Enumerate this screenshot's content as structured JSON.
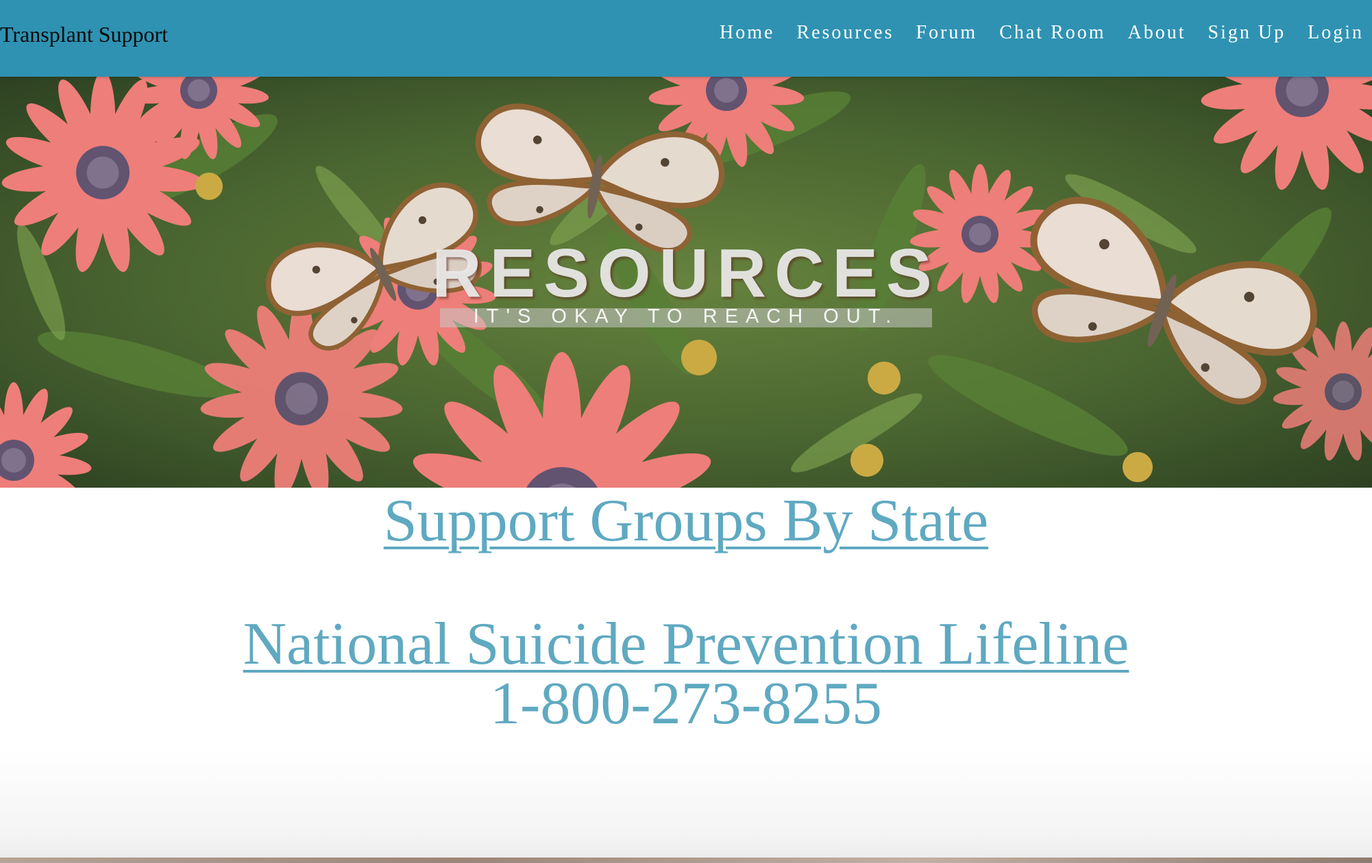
{
  "navbar": {
    "brand": "Transplant Support",
    "links": [
      {
        "label": "Home"
      },
      {
        "label": "Resources"
      },
      {
        "label": "Forum"
      },
      {
        "label": "Chat Room"
      },
      {
        "label": "About"
      },
      {
        "label": "Sign Up"
      },
      {
        "label": "Login"
      }
    ],
    "background_color": "#2f92b2",
    "link_color": "#ffffff"
  },
  "hero": {
    "title": "RESOURCES",
    "subtitle": "IT'S OKAY TO REACH OUT.",
    "image_description_icon": "butterflies-flowers-photo"
  },
  "content": {
    "support_groups_link": "Support Groups By State",
    "lifeline_link": "National Suicide Prevention Lifeline",
    "lifeline_phone": "1-800-273-8255",
    "link_color": "#5fa9c1"
  }
}
